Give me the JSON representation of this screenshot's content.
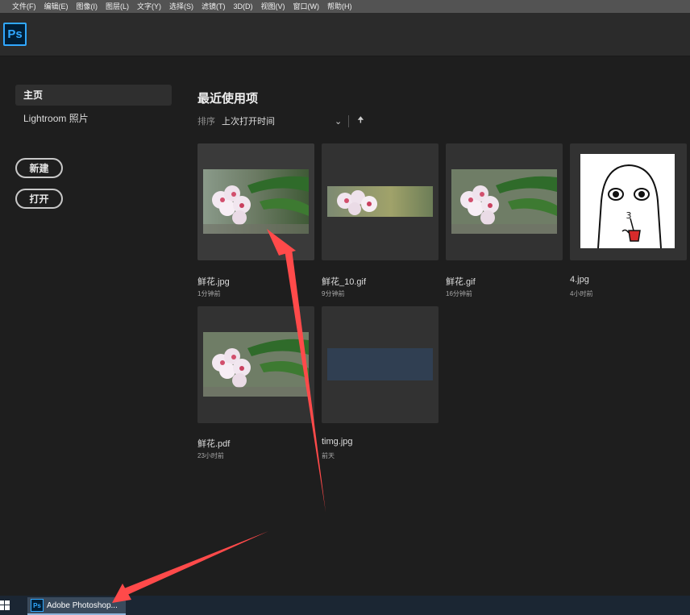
{
  "menubar": {
    "items": [
      "文件(F)",
      "编辑(E)",
      "图像(I)",
      "图层(L)",
      "文字(Y)",
      "选择(S)",
      "滤镜(T)",
      "3D(D)",
      "视图(V)",
      "窗口(W)",
      "帮助(H)"
    ]
  },
  "app": {
    "logo_text": "Ps"
  },
  "sidebar": {
    "nav": [
      "主页",
      "Lightroom 照片"
    ],
    "new_button": "新建",
    "open_button": "打开"
  },
  "main": {
    "title": "最近使用项",
    "sort_label": "排序",
    "sort_value": "上次打开时间",
    "files": [
      {
        "name": "鲜花.jpg",
        "time": "1分钟前",
        "thumb": "flower"
      },
      {
        "name": "鲜花_10.gif",
        "time": "9分钟前",
        "thumb": "flower-strip"
      },
      {
        "name": "鲜花.gif",
        "time": "16分钟前",
        "thumb": "flower"
      },
      {
        "name": "4.jpg",
        "time": "4小时前",
        "thumb": "sticker"
      },
      {
        "name": "鲜花.pdf",
        "time": "23小时前",
        "thumb": "flower"
      },
      {
        "name": "timg.jpg",
        "time": "前天",
        "thumb": "texture"
      }
    ]
  },
  "taskbar": {
    "app_icon_text": "Ps",
    "app_label": "Adobe Photoshop..."
  },
  "annotation_color": "#ff4a4a"
}
